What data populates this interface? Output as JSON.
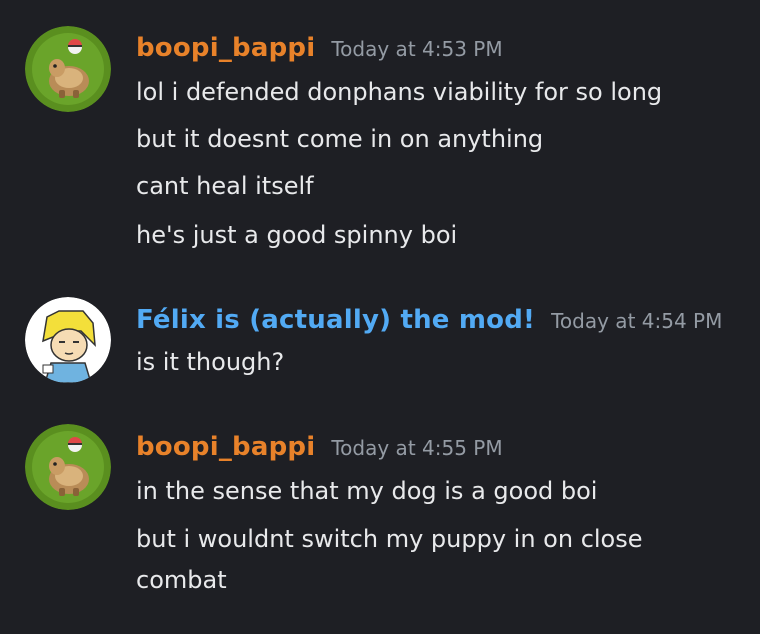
{
  "colors": {
    "background": "#1e1f24",
    "boopi_name": "#e8822a",
    "felix_name": "#52aaf4",
    "timestamp": "#949ba4",
    "message_text": "#e8e9eb"
  },
  "messages": [
    {
      "username": "boopi_bappi",
      "timestamp": "Today at 4:53 PM",
      "avatar_icon": "pokemon-donphan-avatar-icon",
      "lines": [
        "lol i defended donphans viability for so long",
        "but it doesnt come in on anything",
        "cant heal itself",
        "he's just a good spinny boi"
      ]
    },
    {
      "username": "Félix is (actually) the mod!",
      "timestamp": "Today at 4:54 PM",
      "avatar_icon": "cartoon-blond-character-avatar-icon",
      "lines": [
        "is it though?"
      ]
    },
    {
      "username": "boopi_bappi",
      "timestamp": "Today at 4:55 PM",
      "avatar_icon": "pokemon-donphan-avatar-icon",
      "lines": [
        "in the sense that my dog is a good boi",
        "but i wouldnt switch my puppy in on close",
        "combat"
      ]
    }
  ]
}
